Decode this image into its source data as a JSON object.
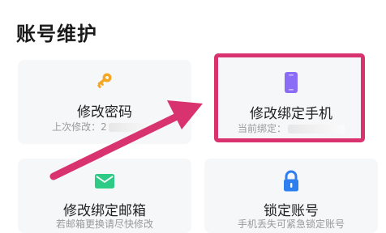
{
  "section": {
    "title": "账号维护"
  },
  "cards": {
    "password": {
      "label": "修改密码",
      "sub": "上次修改：2",
      "icon": "key-icon",
      "icon_color": "#f5a623"
    },
    "phone": {
      "label": "修改绑定手机",
      "sub": "当前绑定：",
      "icon": "phone-icon",
      "icon_color": "#8b6cf6"
    },
    "email": {
      "label": "修改绑定邮箱",
      "sub": "若邮箱更换请尽快修改",
      "icon": "envelope-icon",
      "icon_color": "#2ecb86"
    },
    "lock": {
      "label": "锁定账号",
      "sub": "手机丢失可紧急锁定账号",
      "icon": "lock-icon",
      "icon_color": "#2d7ff0"
    }
  },
  "annotation": {
    "color": "#d9336f"
  }
}
